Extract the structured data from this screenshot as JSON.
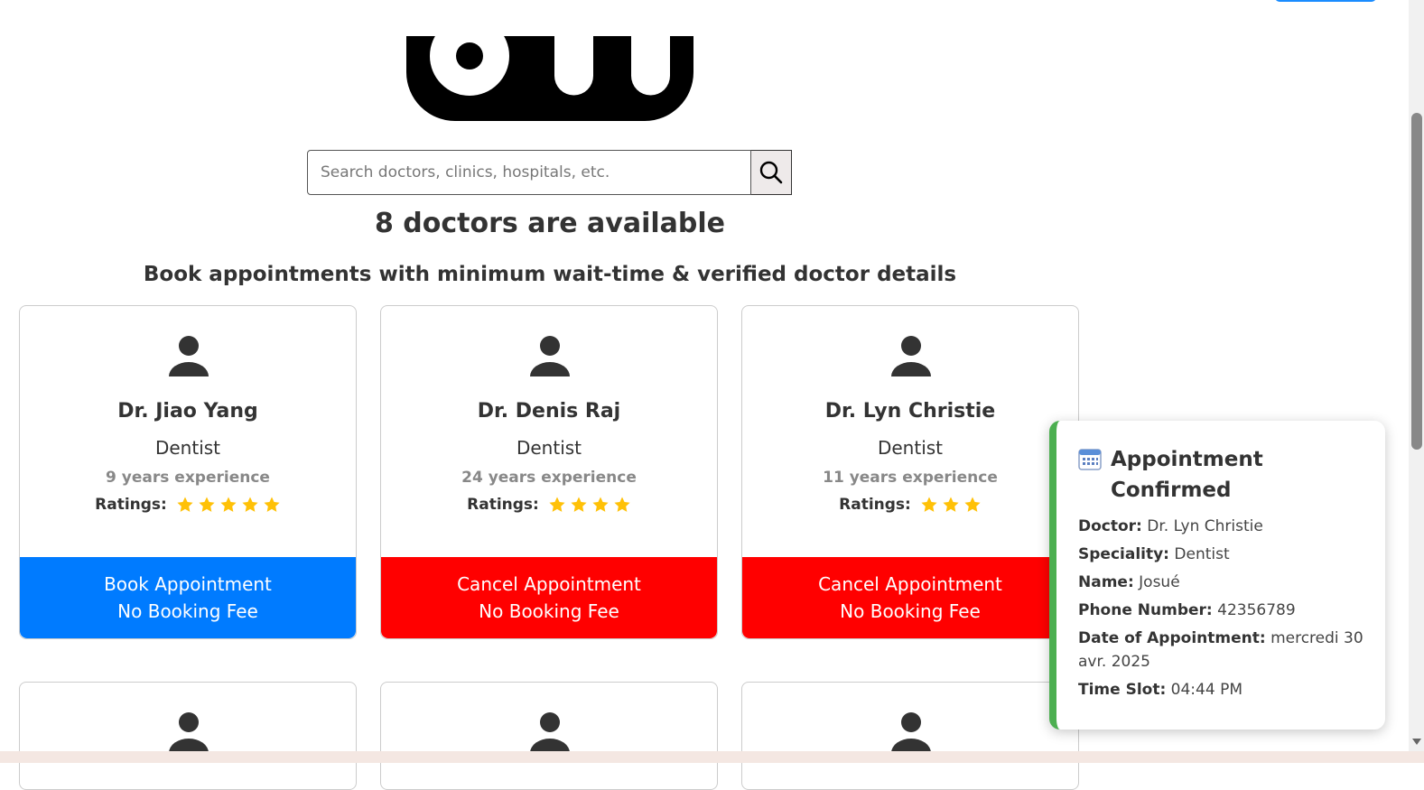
{
  "search": {
    "placeholder": "Search doctors, clinics, hospitals, etc."
  },
  "headings": {
    "count": "8 doctors are available",
    "subtitle": "Book appointments with minimum wait-time & verified doctor details"
  },
  "doctors": [
    {
      "name": "Dr. Jiao Yang",
      "speciality": "Dentist",
      "experience": "9 years experience",
      "ratings_label": "Ratings:",
      "stars": 5,
      "action": "Book Appointment",
      "fee": "No Booking Fee",
      "action_type": "book"
    },
    {
      "name": "Dr. Denis Raj",
      "speciality": "Dentist",
      "experience": "24 years experience",
      "ratings_label": "Ratings:",
      "stars": 4,
      "action": "Cancel Appointment",
      "fee": "No Booking Fee",
      "action_type": "cancel"
    },
    {
      "name": "Dr. Lyn Christie",
      "speciality": "Dentist",
      "experience": "11 years experience",
      "ratings_label": "Ratings:",
      "stars": 3,
      "action": "Cancel Appointment",
      "fee": "No Booking Fee",
      "action_type": "cancel"
    }
  ],
  "toast": {
    "title": "Appointment Confirmed",
    "doctor_label": "Doctor:",
    "doctor": "Dr. Lyn Christie",
    "speciality_label": "Speciality:",
    "speciality": "Dentist",
    "name_label": "Name:",
    "name": "Josué",
    "phone_label": "Phone Number:",
    "phone": "42356789",
    "date_label": "Date of Appointment:",
    "date": "mercredi 30 avr. 2025",
    "time_label": "Time Slot:",
    "time": "04:44 PM"
  },
  "colors": {
    "book": "#007bff",
    "cancel": "#ff0000",
    "star": "#ffc107",
    "toast_accent": "#4caf50"
  },
  "icons": {
    "search": "search-icon",
    "avatar": "user-icon",
    "star": "star-icon",
    "calendar": "calendar-icon"
  }
}
